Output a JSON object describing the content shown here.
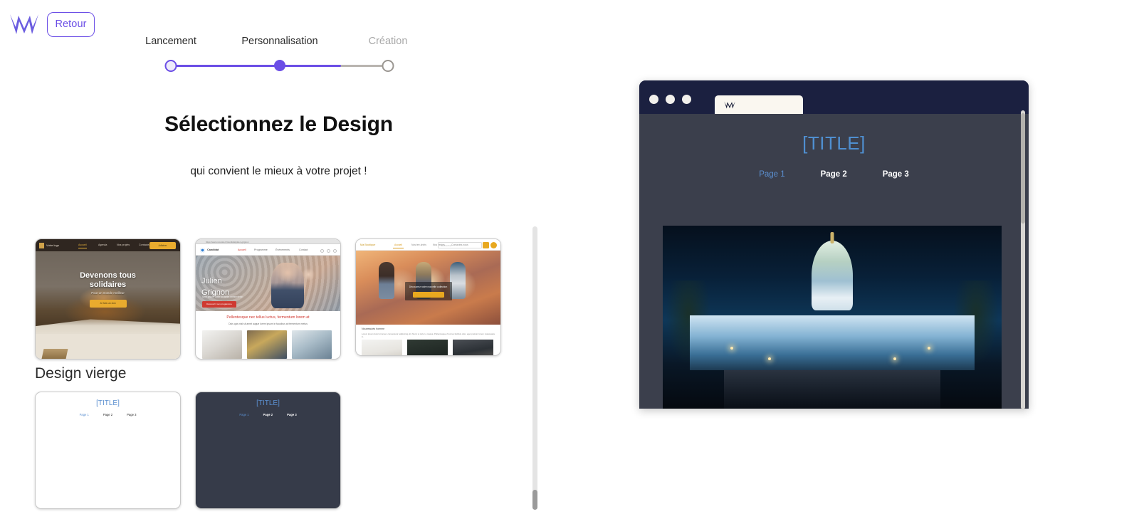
{
  "header": {
    "logo_icon": "w-logo-icon",
    "back_label": "Retour"
  },
  "stepper": {
    "steps": [
      {
        "label": "Lancement",
        "state": "done"
      },
      {
        "label": "Personnalisation",
        "state": "active"
      },
      {
        "label": "Création",
        "state": "todo"
      }
    ],
    "fill_percent": 78,
    "accent_color": "#6b4ee6",
    "track_color": "#b9b5b0"
  },
  "main": {
    "title": "Sélectionnez le Design",
    "subtitle": "qui convient le mieux à votre projet !",
    "blank_section_heading": "Design vierge"
  },
  "themes": [
    {
      "name": "solidarite",
      "nav_logo_text": "Votre logo",
      "nav_links": [
        "Accueil",
        "Agenda",
        "Nos projets",
        "Contactez-nous"
      ],
      "nav_cta": "Adhérer",
      "hero_title_line1": "Devenons tous",
      "hero_title_line2": "solidaires",
      "hero_subtitle": "Pour un monde meilleur",
      "hero_button": "Je fais un don"
    },
    {
      "name": "candidat",
      "url_text": "https://www.monsite.fr/candidat/julien-grignon",
      "brand": "Candidat",
      "nav_links": [
        "Accueil",
        "Programme",
        "Événements",
        "Contact"
      ],
      "hero_title_line1": "Julien",
      "hero_title_line2": "Grignon",
      "hero_subtitle": "Sem ipsum dolor sit amet consectetur",
      "hero_button": "Découvrir mon programme",
      "section_title": "Pellentesque nec tellus luctus, fermentum lorem at",
      "section_text": "Duis quis nisl sit amet augue lorem ipsum in faucibus at fermentum metus"
    },
    {
      "name": "boutique",
      "brand": "Ma Boutique",
      "nav_links": [
        "Accueil",
        "Nos tee-shirts",
        "Nos vestes",
        "Contactez-nous"
      ],
      "search_placeholder": "Rechercher...",
      "overlay_title": "Découvrez notre nouvelle collection",
      "overlay_button": "Voir la collection",
      "section_title": "Nouveautés homme",
      "section_text": "Lorem ipsum dolor sit amet, consectetur adipiscing elit. Nunc ut tortor a massa. Pellentesque rhoncus facilisis odio, eget pretium lorem malesuada in."
    }
  ],
  "blank_templates": [
    {
      "name": "blank-light",
      "title": "[TITLE]",
      "nav": [
        "Page 1",
        "Page 2",
        "Page 3"
      ],
      "active_nav_index": 0,
      "theme": "light",
      "image_alt": "cat-under-blanket-photo"
    },
    {
      "name": "blank-dark",
      "title": "[TITLE]",
      "nav": [
        "Page 1",
        "Page 2",
        "Page 3"
      ],
      "active_nav_index": 0,
      "theme": "dark",
      "image_alt": "capitol-building-night-photo"
    }
  ],
  "preview": {
    "tab_favicon": "w-favicon-icon",
    "window_dots": 3,
    "title": "[TITLE]",
    "nav": [
      "Page 1",
      "Page 2",
      "Page 3"
    ],
    "active_nav_index": 0,
    "image_alt": "capitol-building-night-photo",
    "background_color": "#3b3f4c",
    "chrome_color": "#1b2040",
    "title_color": "#4f8fd0"
  }
}
